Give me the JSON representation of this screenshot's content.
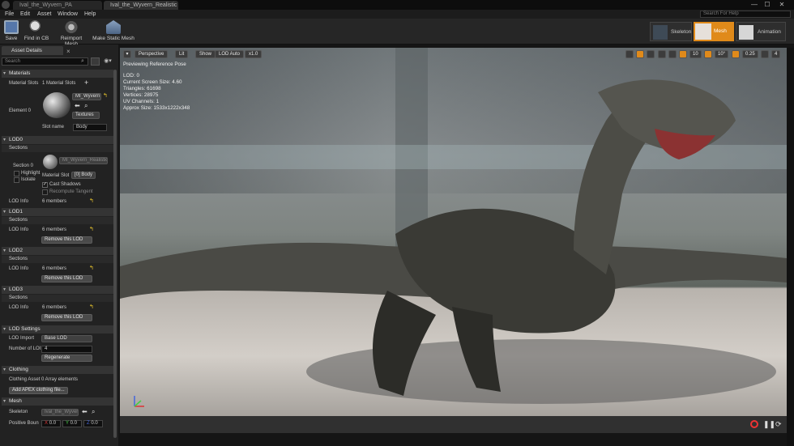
{
  "tabs": [
    {
      "label": "Ival_the_Wyvern_PA",
      "active": false
    },
    {
      "label": "Ival_the_Wyvern_Realistic",
      "active": true
    }
  ],
  "window": {
    "minimize": "—",
    "maximize": "☐",
    "close": "✕"
  },
  "menu": [
    "File",
    "Edit",
    "Asset",
    "Window",
    "Help"
  ],
  "search_help_placeholder": "Search For Help",
  "toolbar": {
    "save": "Save",
    "find_in_cb": "Find in CB",
    "reimport": "Reimport Mesh",
    "make_static": "Make Static Mesh"
  },
  "modes": {
    "skeleton": "Skeleton",
    "mesh": "Mesh",
    "animation": "Animation"
  },
  "details": {
    "tab": "Asset Details",
    "search_placeholder": "Search",
    "materials": {
      "header": "Materials",
      "slots_label": "Material Slots",
      "slots_value": "1 Material Slots",
      "element_label": "Element 0",
      "material_name": "MI_Wyvern",
      "textures": "Textures",
      "slot_name_label": "Slot name",
      "slot_name_value": "Body"
    },
    "lod0": {
      "header": "LOD0",
      "sections": "Sections",
      "section0": "Section 0",
      "material_value": "MI_Wyvern_Realistic",
      "highlight": "Highlight",
      "isolate": "Isolate",
      "material_slot_label": "Material Slot",
      "material_slot_value": "[0] Body",
      "cast_shadows": "Cast Shadows",
      "recompute_tangent": "Recompute Tangent",
      "lod_info": "LOD Info",
      "members": "6 members"
    },
    "lod1": {
      "header": "LOD1",
      "sections": "Sections",
      "lod_info": "LOD Info",
      "members": "6 members",
      "remove": "Remove this LOD"
    },
    "lod2": {
      "header": "LOD2",
      "sections": "Sections",
      "lod_info": "LOD Info",
      "members": "6 members",
      "remove": "Remove this LOD"
    },
    "lod3": {
      "header": "LOD3",
      "sections": "Sections",
      "lod_info": "LOD Info",
      "members": "6 members",
      "remove": "Remove this LOD"
    },
    "lod_settings": {
      "header": "LOD Settings",
      "lod_import_label": "LOD Import",
      "lod_import_value": "Base LOD",
      "number_label": "Number of LOI",
      "number_value": "4",
      "regenerate": "Regenerate"
    },
    "clothing": {
      "header": "Clothing",
      "asset_label": "Clothing Asset",
      "asset_value": "0 Array elements",
      "add_button": "Add APEX clothing file..."
    },
    "mesh": {
      "header": "Mesh",
      "skeleton_label": "Skeleton",
      "skeleton_value": "Ival_the_Wyvern",
      "positive_label": "Positive Boun",
      "x_label": "X",
      "x_value": "0.0",
      "y_label": "Y",
      "y_value": "0.0",
      "z_label": "Z",
      "z_value": "0.0"
    }
  },
  "viewport": {
    "perspective": "Perspective",
    "lit": "Lit",
    "show": "Show",
    "lod_auto": "LOD Auto",
    "speed": "x1.0",
    "preview": "Previewing Reference Pose",
    "stats": [
      "LOD: 0",
      "Current Screen Size: 4.60",
      "Triangles: 61698",
      "Vertices: 28975",
      "UV Channels: 1",
      "Approx Size: 1533x1222x348"
    ],
    "grid_snap": "10",
    "rot_snap": "10°",
    "scale_snap": "0.25",
    "cam_speed": "4"
  },
  "colors": {
    "accent_orange": "#e08a1a",
    "panel": "#222222",
    "yellow_arrow": "#e6c32c"
  }
}
